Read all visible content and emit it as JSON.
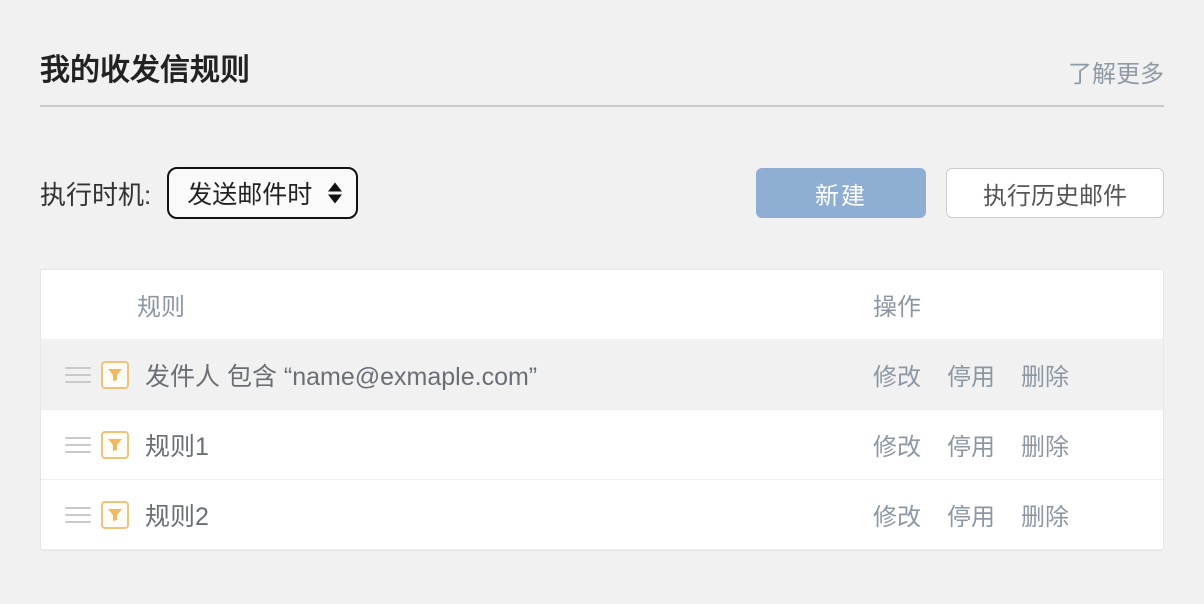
{
  "header": {
    "title": "我的收发信规则",
    "learn_more": "了解更多"
  },
  "toolbar": {
    "timing_label": "执行时机:",
    "timing_value": "发送邮件时",
    "new_btn": "新建",
    "history_btn": "执行历史邮件"
  },
  "table": {
    "head_rule": "规则",
    "head_ops": "操作",
    "op_edit": "修改",
    "op_disable": "停用",
    "op_delete": "删除",
    "rows": [
      {
        "name": "发件人 包含 “name@exmaple.com”",
        "active": true
      },
      {
        "name": "规则1",
        "active": false
      },
      {
        "name": "规则2",
        "active": false
      }
    ]
  }
}
